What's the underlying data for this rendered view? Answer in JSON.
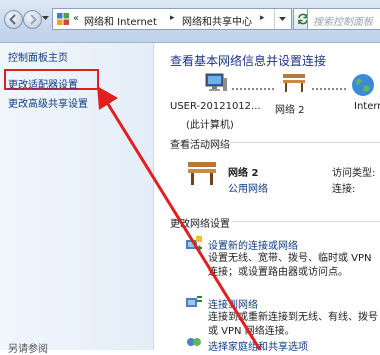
{
  "nav": {
    "breadcrumb_chevron": "«",
    "crumbs": [
      "网络和 Internet",
      "网络和共享中心"
    ],
    "crumb_separator": "▸",
    "search_placeholder": "搜索控制面板"
  },
  "sidebar": {
    "home": "控制面板主页",
    "change_adapter": "更改适配器设置",
    "change_sharing": "更改高级共享设置",
    "see_also": "另请参阅"
  },
  "main": {
    "title": "查看基本网络信息并设置连接",
    "map": {
      "computer_name": "USER-20121012...",
      "computer_note": "(此计算机)",
      "network_name": "网络 2",
      "internet": "Intern"
    },
    "active_section": "查看活动网络",
    "active_network": {
      "name": "网络 2",
      "type": "公用网络",
      "access_type_label": "访问类型:",
      "connection_label": "连接:"
    },
    "change_section": "更改网络设置",
    "tasks": [
      {
        "title": "设置新的连接或网络",
        "desc": "设置无线、宽带、拨号、临时或 VPN 连接；或设置路由器或访问点。"
      },
      {
        "title": "连接到网络",
        "desc": "连接到或重新连接到无线、有线、拨号或 VPN 网络连接。"
      },
      {
        "title": "选择家庭组和共享选项",
        "desc": ""
      }
    ]
  },
  "colors": {
    "link": "#0e3b83",
    "title": "#1e3287",
    "highlight": "#e02020"
  }
}
